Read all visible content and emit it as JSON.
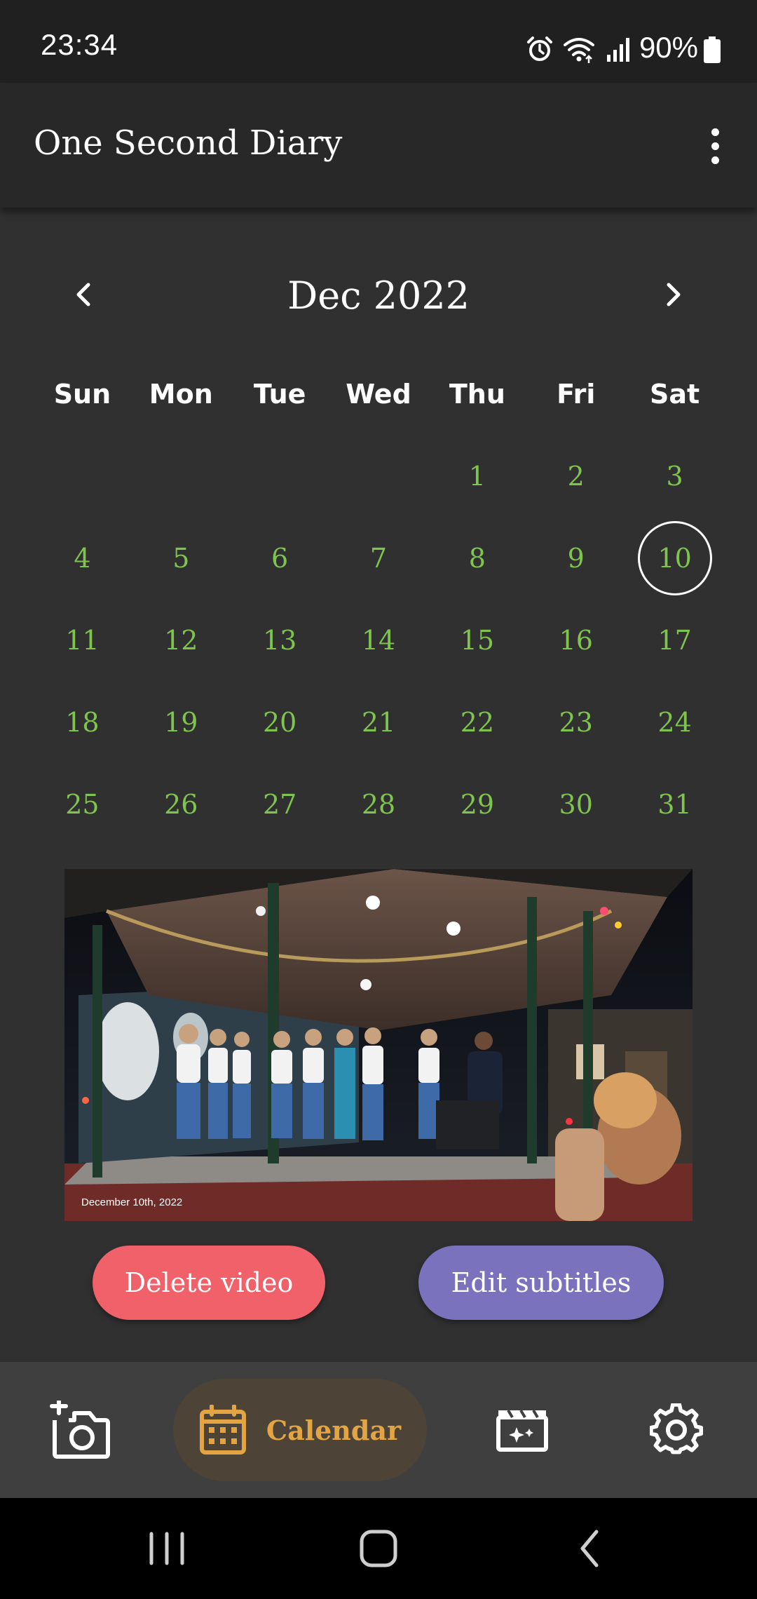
{
  "status_bar": {
    "time": "23:34",
    "battery_percent": "90%",
    "icons": [
      "alarm-icon",
      "wifi-icon",
      "signal-icon",
      "battery-icon"
    ]
  },
  "app_bar": {
    "title": "One Second Diary",
    "menu_icon": "more-vertical-icon"
  },
  "calendar": {
    "month_label": "Dec 2022",
    "prev_icon": "chevron-left-icon",
    "next_icon": "chevron-right-icon",
    "weekdays": [
      "Sun",
      "Mon",
      "Tue",
      "Wed",
      "Thu",
      "Fri",
      "Sat"
    ],
    "weeks": [
      [
        "",
        "",
        "",
        "",
        "1",
        "2",
        "3"
      ],
      [
        "4",
        "5",
        "6",
        "7",
        "8",
        "9",
        "10"
      ],
      [
        "11",
        "12",
        "13",
        "14",
        "15",
        "16",
        "17"
      ],
      [
        "18",
        "19",
        "20",
        "21",
        "22",
        "23",
        "24"
      ],
      [
        "25",
        "26",
        "27",
        "28",
        "29",
        "30",
        "31"
      ]
    ],
    "selected_day": "10",
    "day_color": "#7ec44e"
  },
  "video": {
    "caption": "December 10th, 2022"
  },
  "actions": {
    "delete_label": "Delete video",
    "edit_label": "Edit subtitles",
    "delete_color": "#f0616a",
    "edit_color": "#7a72bd"
  },
  "bottom_nav": {
    "items": [
      {
        "icon": "add-photo-icon",
        "label": ""
      },
      {
        "icon": "calendar-icon",
        "label": "Calendar",
        "active": true
      },
      {
        "icon": "movie-edit-icon",
        "label": ""
      },
      {
        "icon": "gear-icon",
        "label": ""
      }
    ],
    "active_color": "#e3a544"
  },
  "system_nav": {
    "icons": [
      "recents-icon",
      "home-icon",
      "back-icon"
    ]
  }
}
